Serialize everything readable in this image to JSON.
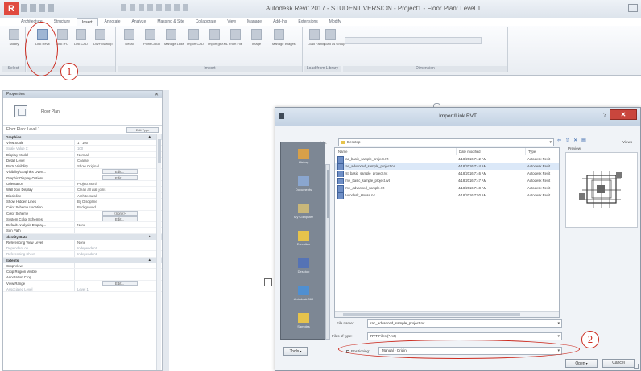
{
  "app": {
    "logo": "R",
    "window_title": "Autodesk Revit 2017 - STUDENT VERSION -     Project1 - Floor Plan: Level 1"
  },
  "ribbon": {
    "tabs": [
      "Architecture",
      "Structure",
      "Insert",
      "Annotate",
      "Analyze",
      "Massing & Site",
      "Collaborate",
      "View",
      "Manage",
      "Add-Ins",
      "Extensions",
      "Modify"
    ],
    "active_tab": "Insert",
    "tools": [
      {
        "label": "Modify",
        "icon": "arrow-cursor-icon"
      },
      {
        "label": "Link Revit",
        "icon": "link-revit-icon"
      },
      {
        "label": "Link IFC",
        "icon": "link-ifc-icon"
      },
      {
        "label": "Link CAD",
        "icon": "link-cad-icon"
      },
      {
        "label": "DWF Markup",
        "icon": "dwf-markup-icon"
      },
      {
        "label": "Decal",
        "icon": "decal-icon"
      },
      {
        "label": "Point Cloud",
        "icon": "point-cloud-icon"
      },
      {
        "label": "Manage Links",
        "icon": "manage-links-icon"
      },
      {
        "label": "Import CAD",
        "icon": "import-cad-icon"
      },
      {
        "label": "Import gbXML",
        "icon": "import-gbxml-icon"
      },
      {
        "label": "From File",
        "icon": "from-file-icon"
      },
      {
        "label": "Image",
        "icon": "image-icon"
      },
      {
        "label": "Manage Images",
        "icon": "manage-images-icon"
      },
      {
        "label": "Load Family",
        "icon": "load-family-icon"
      },
      {
        "label": "Load as Group",
        "icon": "load-group-icon"
      }
    ],
    "panels": [
      "Select",
      "Link",
      "Import",
      "Load from Library",
      "Dimension"
    ]
  },
  "callouts": {
    "one": "1",
    "two": "2"
  },
  "properties": {
    "header": "Properties",
    "type_name": "Floor Plan",
    "instance_label": "Floor Plan: Level 1",
    "edit_type": "Edit Type",
    "sections": [
      {
        "title": "Graphics",
        "rows": [
          {
            "name": "View Scale",
            "value": "1 : 100"
          },
          {
            "name": "Scale Value 1:",
            "value": "100",
            "dim": true
          },
          {
            "name": "Display Model",
            "value": "Normal"
          },
          {
            "name": "Detail Level",
            "value": "Coarse"
          },
          {
            "name": "Parts Visibility",
            "value": "Show Original"
          },
          {
            "name": "Visibility/Graphics Overr...",
            "value": "Edit...",
            "button": true
          },
          {
            "name": "Graphic Display Options",
            "value": "Edit...",
            "button": true
          },
          {
            "name": "Orientation",
            "value": "Project North"
          },
          {
            "name": "Wall Join Display",
            "value": "Clean all wall joins"
          },
          {
            "name": "Discipline",
            "value": "Architectural"
          },
          {
            "name": "Show Hidden Lines",
            "value": "By Discipline"
          },
          {
            "name": "Color Scheme Location",
            "value": "Background"
          },
          {
            "name": "Color Scheme",
            "value": "<none>",
            "button": true
          },
          {
            "name": "System Color Schemes",
            "value": "Edit...",
            "button": true
          },
          {
            "name": "Default Analysis Display...",
            "value": "None"
          },
          {
            "name": "Sun Path",
            "value": ""
          }
        ]
      },
      {
        "title": "Identity Data",
        "rows": [
          {
            "name": "Referencing View Level",
            "value": "None"
          },
          {
            "name": "Dependent on",
            "value": "Independent",
            "dim": true
          },
          {
            "name": "Referencing Sheet",
            "value": "Independent",
            "dim": true
          }
        ]
      },
      {
        "title": "Extents",
        "rows": [
          {
            "name": "Crop View",
            "value": ""
          },
          {
            "name": "Crop Region Visible",
            "value": ""
          },
          {
            "name": "Annotation Crop",
            "value": ""
          },
          {
            "name": "View Range",
            "value": "Edit...",
            "button": true
          },
          {
            "name": "Associated Level",
            "value": "Level 1",
            "dim": true
          }
        ]
      }
    ]
  },
  "dialog": {
    "title": "Import/Link RVT",
    "help": "?",
    "close": "✕",
    "look_in_label": "Look in:",
    "look_in_value": "Desktop",
    "views_label": "Views",
    "places": [
      "History",
      "Documents",
      "My Computer",
      "Favorites",
      "Desktop",
      "Autodesk 360",
      "Samples"
    ],
    "columns": [
      "Name",
      "Date modified",
      "Type"
    ],
    "files": [
      {
        "name": "rac_basic_sample_project.rvt",
        "date": "4/18/2016 7:42 AM",
        "type": "Autodesk Revit"
      },
      {
        "name": "rac_advanced_sample_project.rvt",
        "date": "4/18/2016 7:44 AM",
        "type": "Autodesk Revit",
        "selected": true
      },
      {
        "name": "rst_basic_sample_project.rvt",
        "date": "4/18/2016 7:46 AM",
        "type": "Autodesk Revit"
      },
      {
        "name": "rme_basic_sample_project.rvt",
        "date": "4/18/2016 7:47 AM",
        "type": "Autodesk Revit"
      },
      {
        "name": "rme_advanced_sample.rvt",
        "date": "4/18/2016 7:48 AM",
        "type": "Autodesk Revit"
      },
      {
        "name": "Autodesk_House.rvt",
        "date": "4/18/2016 7:50 AM",
        "type": "Autodesk Revit"
      }
    ],
    "preview_label": "Preview",
    "file_name_label": "File name:",
    "file_name_value": "rac_advanced_sample_project.rvt",
    "file_type_label": "Files of type:",
    "file_type_value": "RVT Files (*.rvt)",
    "positioning_label": "Positioning:",
    "positioning_value": "Manual - Origin",
    "tools_btn": "Tools",
    "open_btn": "Open",
    "cancel_btn": "Cancel"
  }
}
